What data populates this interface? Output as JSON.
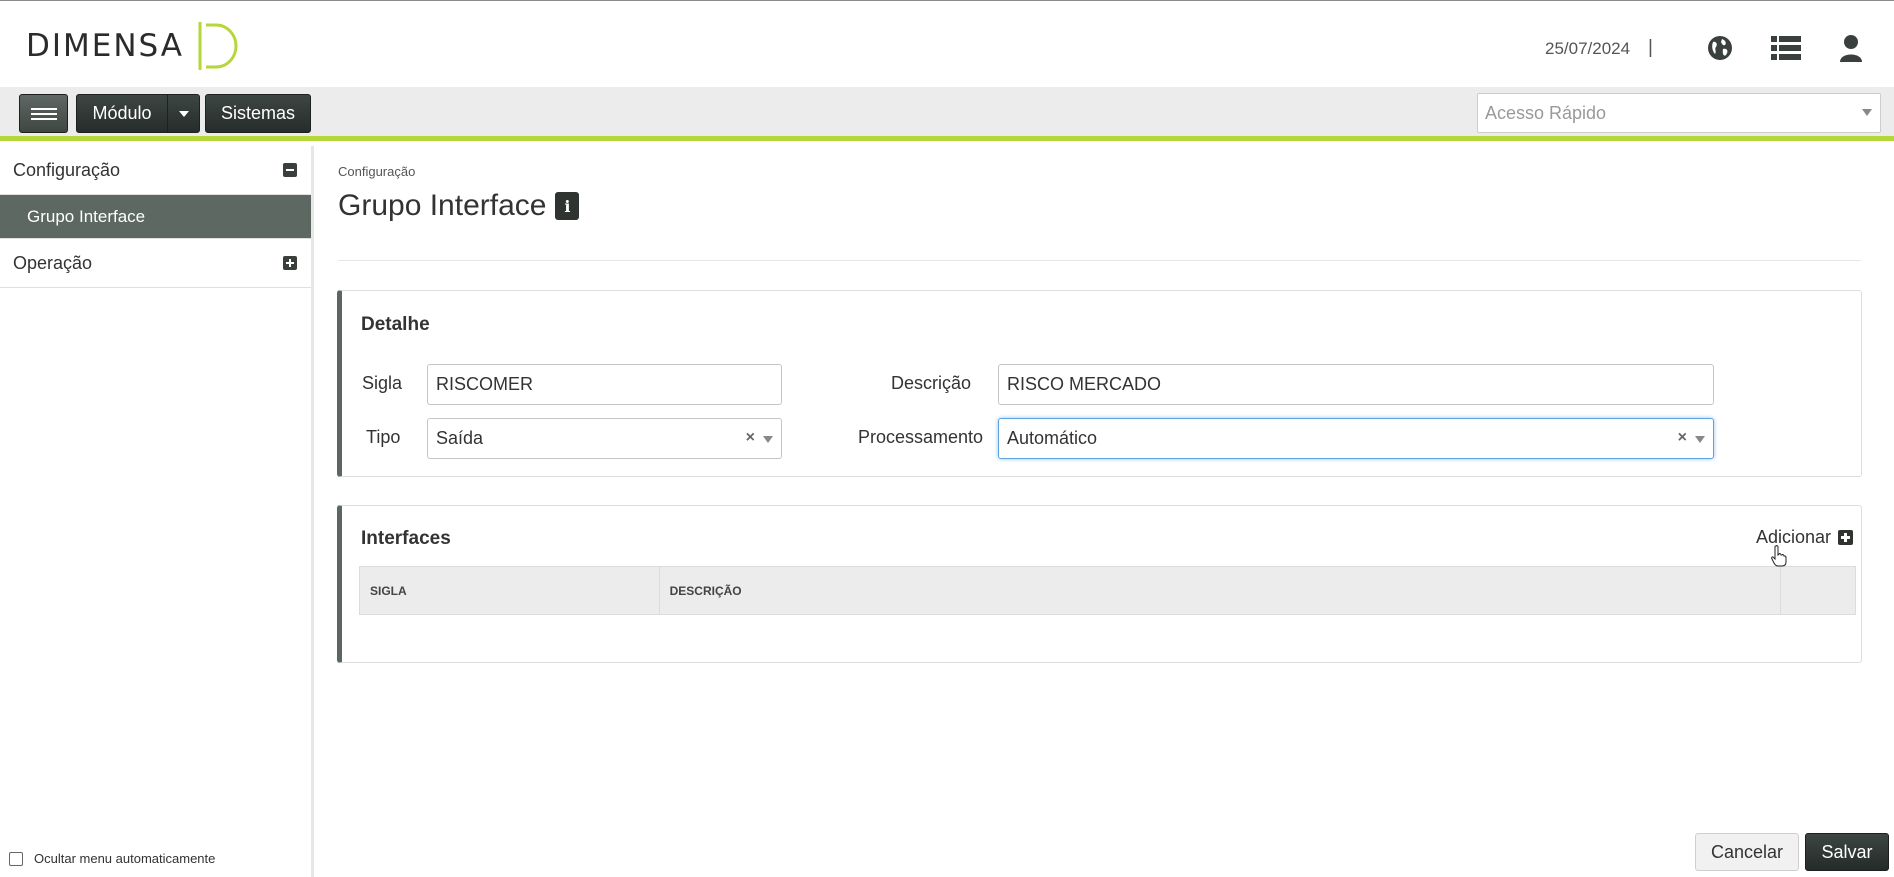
{
  "header": {
    "logo_text": "DIMENSA",
    "date": "25/07/2024",
    "separator": "|",
    "icons": [
      "globe-icon",
      "list-icon",
      "user-icon"
    ]
  },
  "toolbar": {
    "module_label": "Módulo",
    "systems_label": "Sistemas",
    "quick_access_placeholder": "Acesso Rápido"
  },
  "sidebar": {
    "groups": [
      {
        "label": "Configuração",
        "expanded": true,
        "items": [
          "Grupo Interface"
        ]
      },
      {
        "label": "Operação",
        "expanded": false,
        "items": []
      }
    ],
    "hide_menu_label": "Ocultar menu automaticamente"
  },
  "page": {
    "breadcrumb": "Configuração",
    "title": "Grupo Interface",
    "info_icon": "i"
  },
  "detail": {
    "title": "Detalhe",
    "sigla_label": "Sigla",
    "sigla_value": "RISCOMER",
    "descricao_label": "Descrição",
    "descricao_value": "RISCO MERCADO",
    "tipo_label": "Tipo",
    "tipo_value": "Saída",
    "processamento_label": "Processamento",
    "processamento_value": "Automático"
  },
  "interfaces": {
    "title": "Interfaces",
    "add_label": "Adicionar",
    "columns": [
      "SIGLA",
      "DESCRIÇÃO"
    ],
    "rows": []
  },
  "footer": {
    "cancel_label": "Cancelar",
    "save_label": "Salvar"
  },
  "colors": {
    "accent_green": "#b6d73a",
    "dark_button": "#2f3431",
    "sidebar_selected": "#5d6862"
  }
}
